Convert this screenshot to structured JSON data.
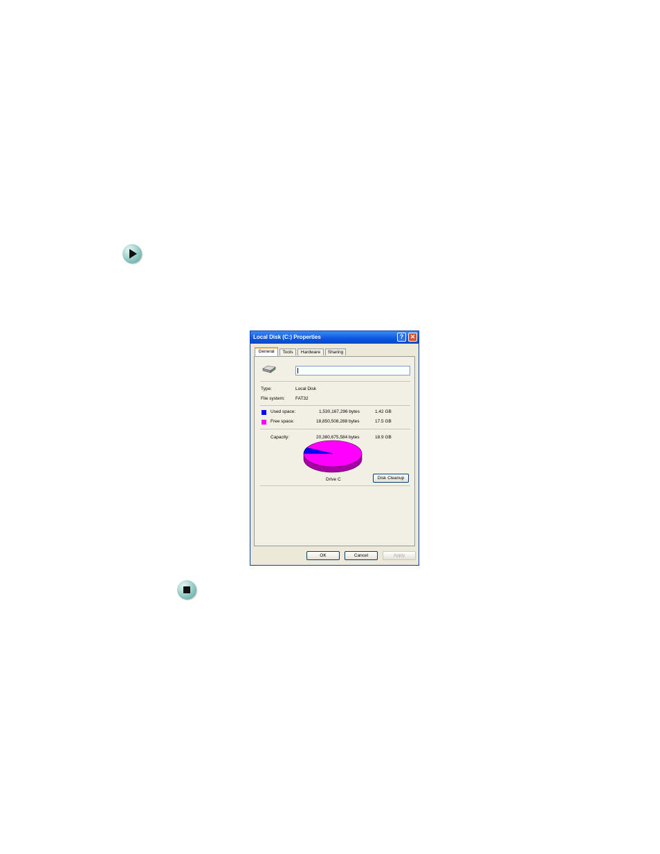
{
  "window": {
    "title": "Local Disk (C:) Properties",
    "help_symbol": "?",
    "close_symbol": "✕"
  },
  "tabs": [
    "General",
    "Tools",
    "Hardware",
    "Sharing"
  ],
  "general": {
    "name_value": "",
    "type_label": "Type:",
    "type_value": "Local Disk",
    "fs_label": "File system:",
    "fs_value": "FAT32",
    "used_label": "Used space:",
    "used_bytes": "1,530,167,296 bytes",
    "used_gb": "1.42 GB",
    "free_label": "Free space:",
    "free_bytes": "18,850,508,288 bytes",
    "free_gb": "17.5 GB",
    "capacity_label": "Capacity:",
    "capacity_bytes": "20,380,675,584 bytes",
    "capacity_gb": "18.9 GB",
    "drive_caption": "Drive C",
    "disk_cleanup_label": "Disk Cleanup",
    "used_color": "#0000ff",
    "free_color": "#ff00ff",
    "used_fraction": 0.075
  },
  "buttons": {
    "ok": "OK",
    "cancel": "Cancel",
    "apply": "Apply"
  },
  "icons": {
    "next_step": "play-arrow-icon",
    "end": "stop-square-icon",
    "drive": "hard-drive-icon"
  }
}
